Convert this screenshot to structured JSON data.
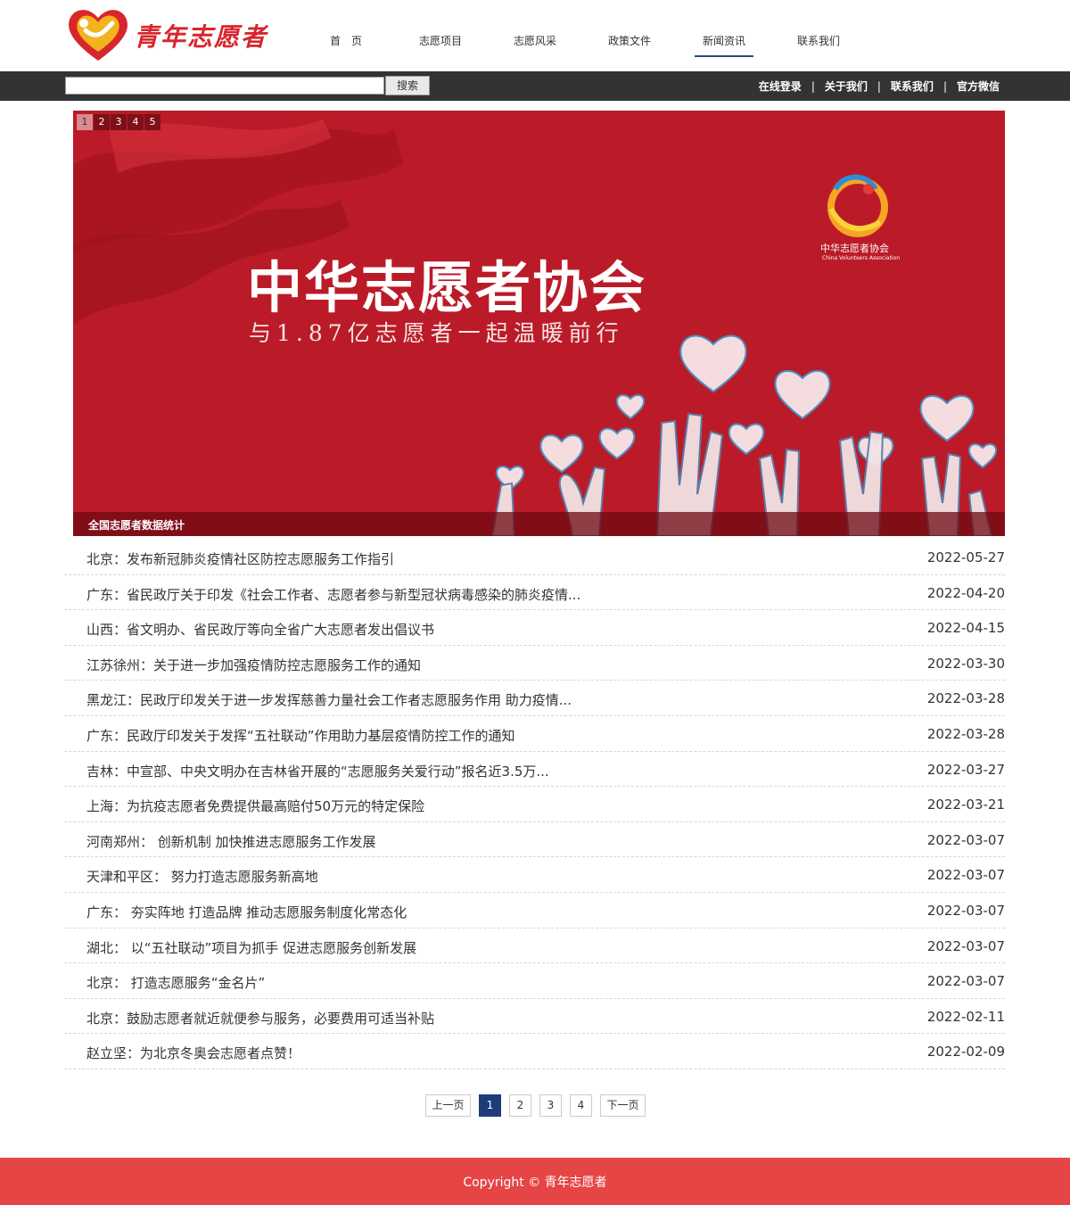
{
  "brand": {
    "name": "青年志愿者"
  },
  "nav": {
    "items": [
      "首　页",
      "志愿项目",
      "志愿风采",
      "政策文件",
      "新闻资讯",
      "联系我们"
    ],
    "active": "新闻资讯"
  },
  "topbar": {
    "search_placeholder": "",
    "search_button": "搜索",
    "links": [
      "在线登录",
      "关于我们",
      "联系我们",
      "官方微信"
    ],
    "separator": "|"
  },
  "banner": {
    "pages": [
      "1",
      "2",
      "3",
      "4",
      "5"
    ],
    "current_page": "1",
    "title": "中华志愿者协会",
    "subtitle": "与1.87亿志愿者一起温暖前行",
    "org_name": "中华志愿者协会",
    "org_name_en": "China Volunteers Association",
    "caption": "全国志愿者数据统计"
  },
  "news": [
    {
      "title": "北京：发布新冠肺炎疫情社区防控志愿服务工作指引",
      "date": "2022-05-27"
    },
    {
      "title": "广东：省民政厅关于印发《社会工作者、志愿者参与新型冠状病毒感染的肺炎疫情...",
      "date": "2022-04-20"
    },
    {
      "title": "山西：省文明办、省民政厅等向全省广大志愿者发出倡议书",
      "date": "2022-04-15"
    },
    {
      "title": "江苏徐州：关于进一步加强疫情防控志愿服务工作的通知",
      "date": "2022-03-30"
    },
    {
      "title": "黑龙江：民政厅印发关于进一步发挥慈善力量社会工作者志愿服务作用 助力疫情...",
      "date": "2022-03-28"
    },
    {
      "title": "广东：民政厅印发关于发挥“五社联动”作用助力基层疫情防控工作的通知",
      "date": "2022-03-28"
    },
    {
      "title": "吉林：中宣部、中央文明办在吉林省开展的“志愿服务关爱行动”报名近3.5万...",
      "date": "2022-03-27"
    },
    {
      "title": "上海：为抗疫志愿者免费提供最高赔付50万元的特定保险",
      "date": "2022-03-21"
    },
    {
      "title": "河南郑州： 创新机制 加快推进志愿服务工作发展",
      "date": "2022-03-07"
    },
    {
      "title": "天津和平区： 努力打造志愿服务新高地",
      "date": "2022-03-07"
    },
    {
      "title": "广东： 夯实阵地 打造品牌 推动志愿服务制度化常态化",
      "date": "2022-03-07"
    },
    {
      "title": "湖北： 以“五社联动”项目为抓手 促进志愿服务创新发展",
      "date": "2022-03-07"
    },
    {
      "title": "北京： 打造志愿服务“金名片”",
      "date": "2022-03-07"
    },
    {
      "title": "北京：鼓励志愿者就近就便参与服务，必要费用可适当补贴",
      "date": "2022-02-11"
    },
    {
      "title": "赵立坚：为北京冬奥会志愿者点赞！",
      "date": "2022-02-09"
    }
  ],
  "pagination": {
    "prev": "上一页",
    "pages": [
      "1",
      "2",
      "3",
      "4"
    ],
    "current": "1",
    "next": "下一页"
  },
  "footer": {
    "copyright": "Copyright © 青年志愿者"
  },
  "colors": {
    "brand_red": "#d8262d",
    "topbar": "#333333",
    "banner": "#bb1b28",
    "footer": "#e64545",
    "pager_active": "#1e3c78"
  }
}
